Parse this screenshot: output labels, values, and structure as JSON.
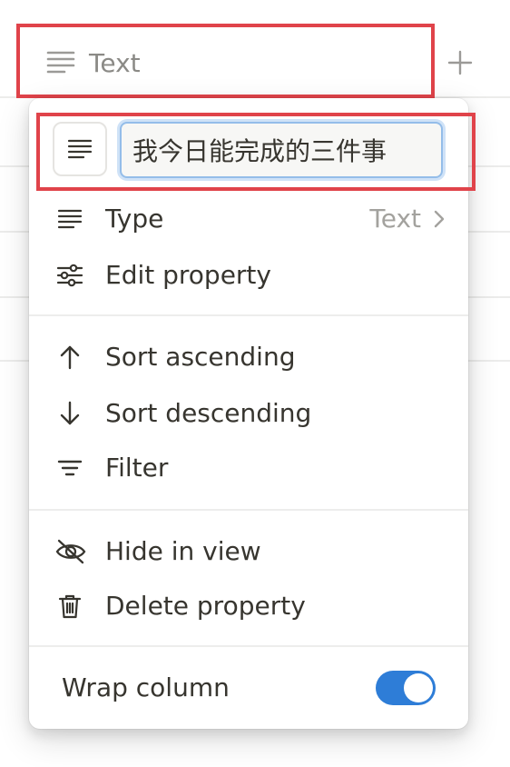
{
  "column_header": {
    "label": "Text",
    "icon": "text-lines-icon"
  },
  "add_column": {
    "icon": "plus-icon"
  },
  "property_editor": {
    "icon": "text-lines-icon",
    "name_value": "我今日能完成的三件事"
  },
  "menu": {
    "items": [
      {
        "id": "type",
        "label": "Type",
        "value": "Text",
        "icon": "text-lines-icon"
      },
      {
        "id": "edit",
        "label": "Edit property",
        "icon": "sliders-icon"
      },
      {
        "id": "sort_asc",
        "label": "Sort ascending",
        "icon": "arrow-up-icon"
      },
      {
        "id": "sort_desc",
        "label": "Sort descending",
        "icon": "arrow-down-icon"
      },
      {
        "id": "filter",
        "label": "Filter",
        "icon": "filter-icon"
      },
      {
        "id": "hide",
        "label": "Hide in view",
        "icon": "eye-slash-icon"
      },
      {
        "id": "delete",
        "label": "Delete property",
        "icon": "trash-icon"
      }
    ],
    "wrap_column": {
      "label": "Wrap column",
      "enabled": true
    }
  },
  "colors": {
    "accent": "#2e7dd7",
    "annotation": "#e0434a",
    "text": "#37352f",
    "muted": "#8b8a86"
  }
}
